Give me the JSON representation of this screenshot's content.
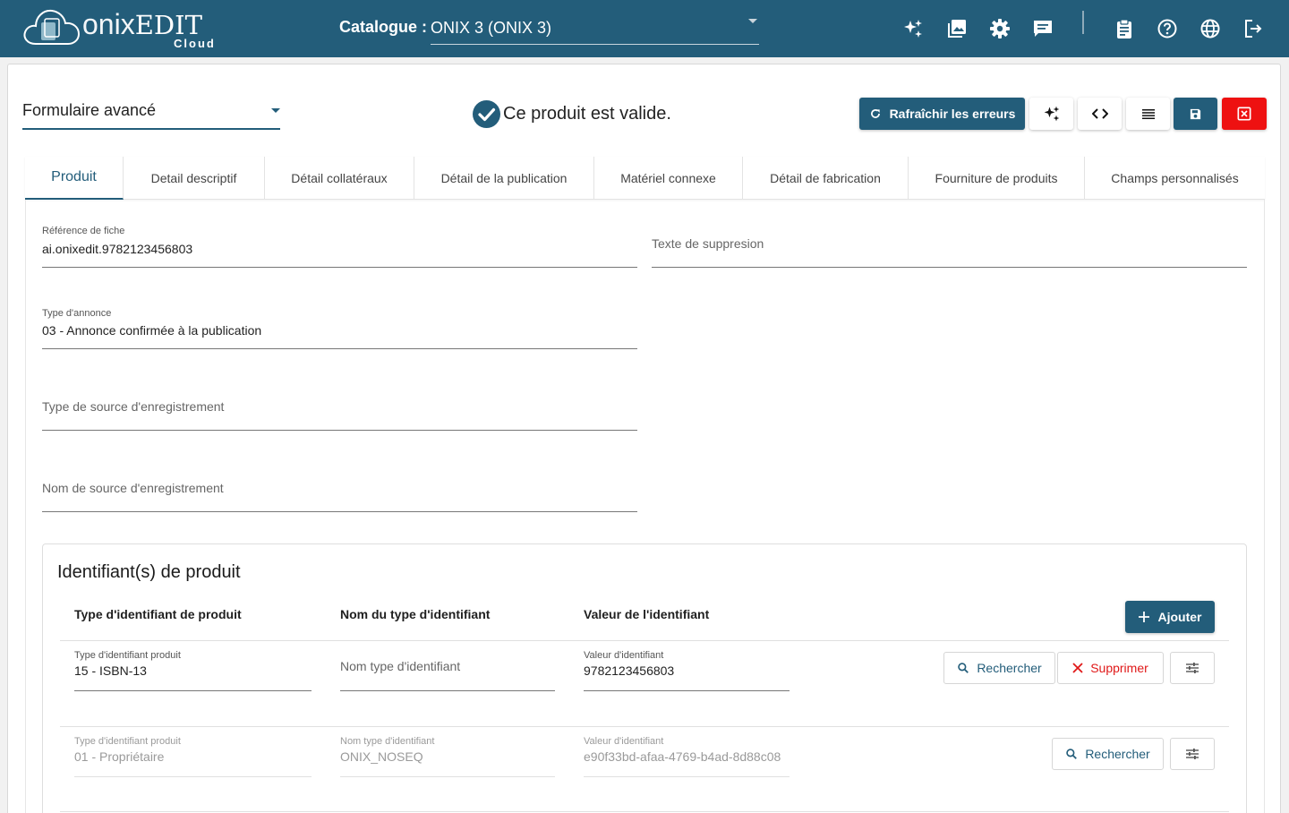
{
  "header": {
    "logo_text_a": "onix",
    "logo_text_b": "EDIT",
    "logo_sub": "Cloud",
    "catalogue_label": "Catalogue :",
    "catalogue_value": "ONIX 3 (ONIX 3)",
    "icons": [
      "sparkles-icon",
      "images-icon",
      "gear-icon",
      "chat-icon",
      "clipboard-icon",
      "help-icon",
      "globe-icon",
      "logout-icon"
    ]
  },
  "toolbar": {
    "form_mode": "Formulaire avancé",
    "valid_text": "Ce produit est valide.",
    "refresh_label": "Rafraîchir les erreurs"
  },
  "tabs": [
    "Produit",
    "Detail descriptif",
    "Détail collatéraux",
    "Détail de la publication",
    "Matériel connexe",
    "Détail de fabrication",
    "Fourniture de produits",
    "Champs personnalisés"
  ],
  "fields": {
    "ref_label": "Référence de fiche",
    "ref_value": "ai.onixedit.9782123456803",
    "suppression_placeholder": "Texte de suppresion",
    "announce_label": "Type d'annonce",
    "announce_value": "03 - Annonce confirmée à la publication",
    "source_type_placeholder": "Type de source d'enregistrement",
    "source_name_placeholder": "Nom de source d'enregistrement"
  },
  "identifiers": {
    "title": "Identifiant(s) de produit",
    "col_type": "Type d'identifiant de produit",
    "col_name": "Nom du type d'identifiant",
    "col_value": "Valeur de l'identifiant",
    "add_label": "Ajouter",
    "search_label": "Rechercher",
    "delete_label": "Supprimer",
    "rows": [
      {
        "type_label": "Type d'identifiant produit",
        "type_value": "15 - ISBN-13",
        "name_placeholder": "Nom type d'identifiant",
        "value_label": "Valeur d'identifiant",
        "value": "9782123456803"
      },
      {
        "type_label": "Type d'identifiant produit",
        "type_value": "01 - Propriétaire",
        "name_label": "Nom type d'identifiant",
        "name_value": "ONIX_NOSEQ",
        "value_label": "Valeur d'identifiant",
        "value": "e90f33bd-afaa-4769-b4ad-8d88c08"
      }
    ]
  },
  "colors": {
    "brand": "#235d7a",
    "danger": "#ee1111"
  }
}
